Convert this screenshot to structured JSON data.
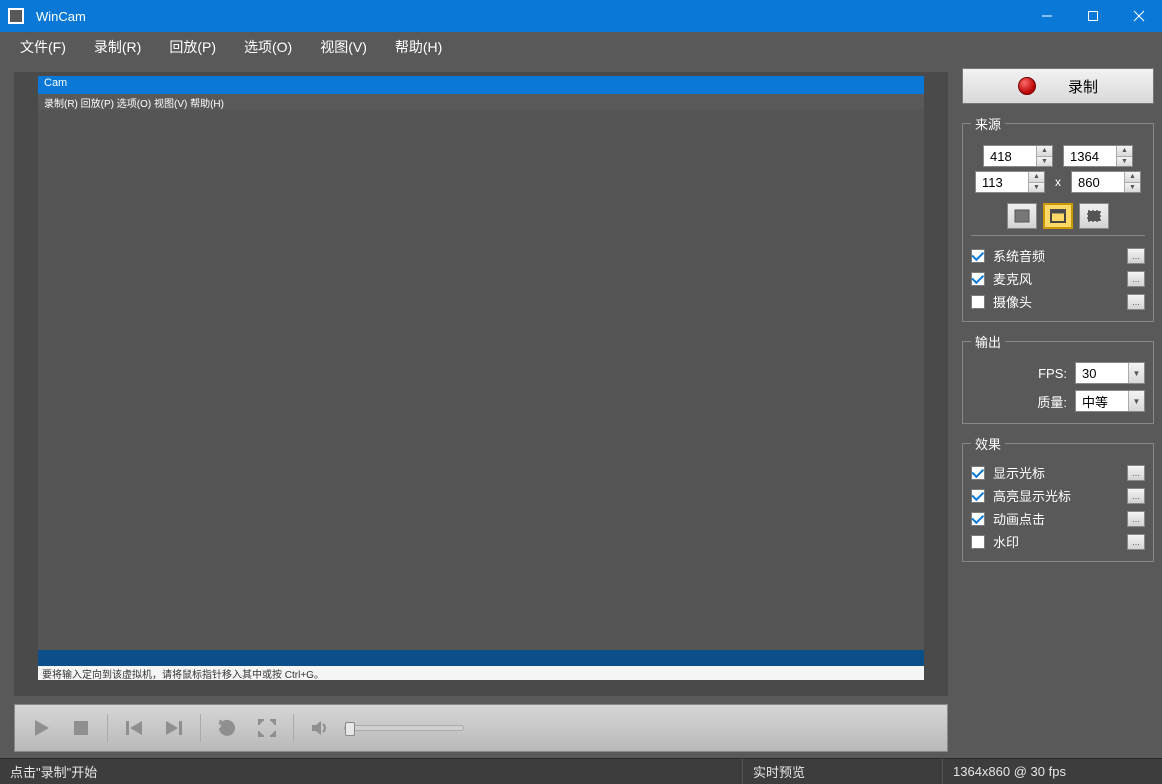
{
  "window": {
    "title": "WinCam"
  },
  "menu": {
    "items": [
      "文件(F)",
      "录制(R)",
      "回放(P)",
      "选项(O)",
      "视图(V)",
      "帮助(H)"
    ]
  },
  "preview_inner": {
    "title": "Cam",
    "menu": "录制(R)   回放(P)   选项(O)   视图(V)   帮助(H)",
    "bottom_hint": "要将输入定向到该虚拟机，请将鼠标指针移入其中或按 Ctrl+G。"
  },
  "player": {
    "volume": 0
  },
  "panel": {
    "record_label": "录制",
    "source": {
      "legend": "来源",
      "width": "418",
      "height": "113",
      "out_w": "1364",
      "out_h": "860",
      "x_label": "x",
      "items": [
        {
          "label": "系统音频",
          "checked": true
        },
        {
          "label": "麦克风",
          "checked": true
        },
        {
          "label": "摄像头",
          "checked": false
        }
      ]
    },
    "output": {
      "legend": "输出",
      "fps_label": "FPS:",
      "fps_value": "30",
      "quality_label": "质量:",
      "quality_value": "中等"
    },
    "effects": {
      "legend": "效果",
      "items": [
        {
          "label": "显示光标",
          "checked": true
        },
        {
          "label": "高亮显示光标",
          "checked": true
        },
        {
          "label": "动画点击",
          "checked": true
        },
        {
          "label": "水印",
          "checked": false
        }
      ]
    }
  },
  "status": {
    "hint": "点击\"录制\"开始",
    "mode": "实时预览",
    "dims": "1364x860 @ 30 fps"
  }
}
